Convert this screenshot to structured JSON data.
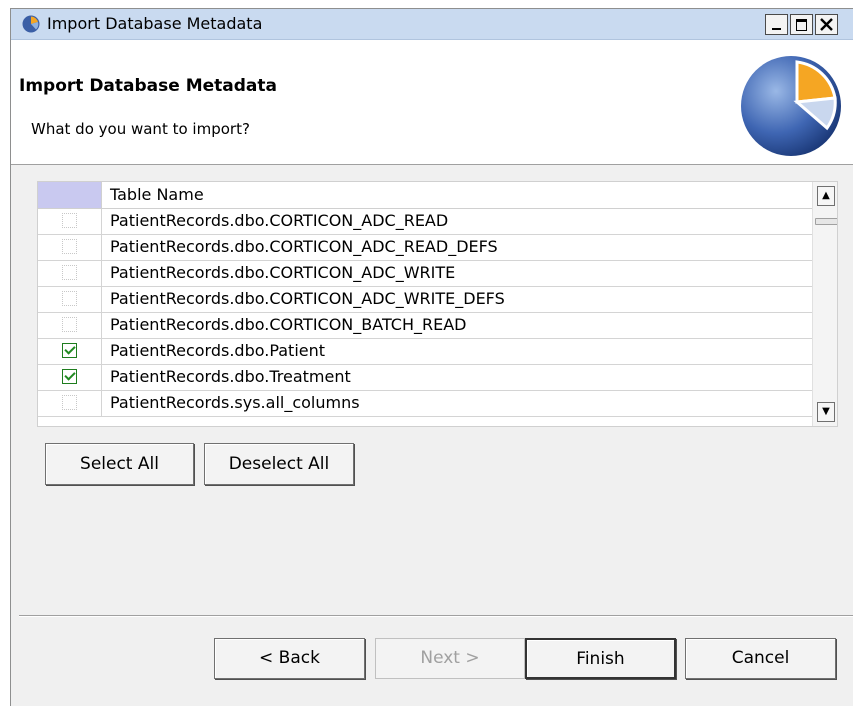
{
  "window": {
    "title": "Import Database Metadata",
    "icon": "app-logo-icon"
  },
  "banner": {
    "title": "Import Database Metadata",
    "subtitle": "What do you want to import?"
  },
  "table": {
    "column_header": "Table Name",
    "rows": [
      {
        "name": "PatientRecords.dbo.CORTICON_ADC_READ",
        "checked": false
      },
      {
        "name": "PatientRecords.dbo.CORTICON_ADC_READ_DEFS",
        "checked": false
      },
      {
        "name": "PatientRecords.dbo.CORTICON_ADC_WRITE",
        "checked": false
      },
      {
        "name": "PatientRecords.dbo.CORTICON_ADC_WRITE_DEFS",
        "checked": false
      },
      {
        "name": "PatientRecords.dbo.CORTICON_BATCH_READ",
        "checked": false
      },
      {
        "name": "PatientRecords.dbo.Patient",
        "checked": true
      },
      {
        "name": "PatientRecords.dbo.Treatment",
        "checked": true
      },
      {
        "name": "PatientRecords.sys.all_columns",
        "checked": false
      }
    ]
  },
  "actions": {
    "select_all": "Select All",
    "deselect_all": "Deselect All"
  },
  "footer": {
    "back": "< Back",
    "next": "Next >",
    "finish": "Finish",
    "cancel": "Cancel"
  }
}
